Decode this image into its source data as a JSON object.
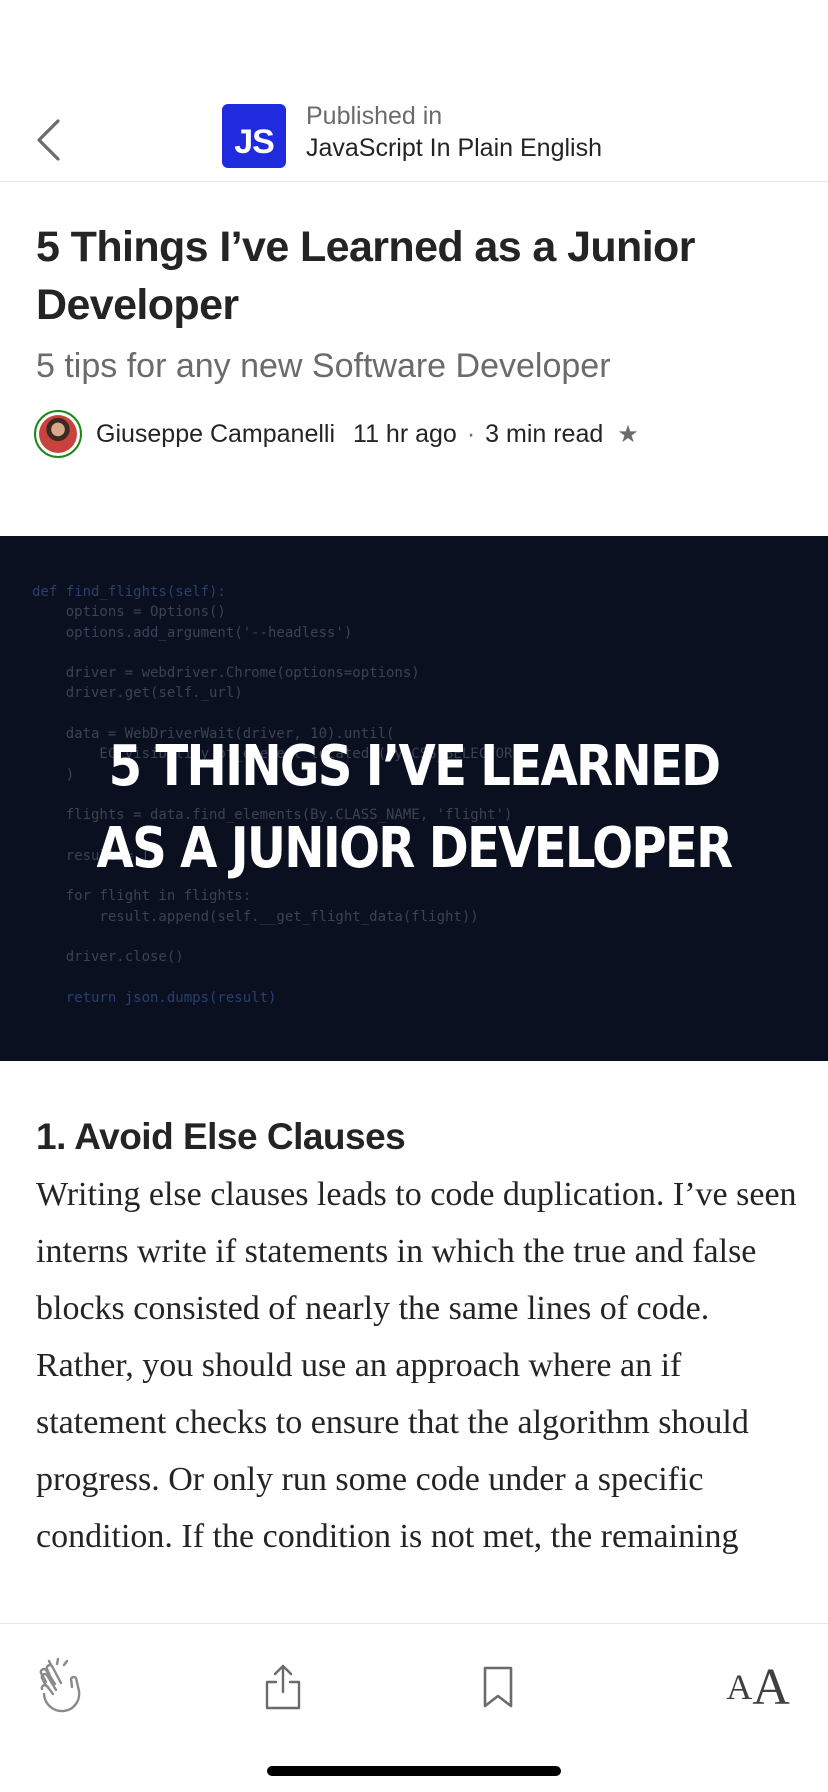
{
  "header": {
    "back_icon": "chevron-left-icon",
    "publication_logo": "JS",
    "published_in_label": "Published in",
    "publication_name": "JavaScript In Plain English"
  },
  "article": {
    "title": "5 Things I’ve Learned as a Junior Developer",
    "subtitle": "5 tips for any new Software Developer",
    "author": "Giuseppe Campanelli",
    "published_ago": "11 hr ago",
    "separator": "·",
    "read_time": "3 min read",
    "member_icon": "star-icon",
    "hero": {
      "headline_line1": "5 THINGS I’VE LEARNED",
      "headline_line2": "AS A JUNIOR DEVELOPER",
      "code_lines": [
        "def find_flights(self):",
        "    options = Options()",
        "    options.add_argument('--headless')",
        "",
        "    driver = webdriver.Chrome(options=options)",
        "    driver.get(self._url)",
        "",
        "    data = WebDriverWait(driver, 10).until(",
        "        EC.visibility_of_element_located((By.CSS_SELECTOR",
        "    )",
        "",
        "    flights = data.find_elements(By.CLASS_NAME, 'flight')",
        "",
        "    result = []",
        "",
        "    for flight in flights:",
        "        result.append(self.__get_flight_data(flight))",
        "",
        "    driver.close()",
        "",
        "    return json.dumps(result)"
      ]
    },
    "section_heading": "1. Avoid Else Clauses",
    "body_text": "Writing else clauses leads to code duplication. I’ve seen interns write if statements in which the true and false blocks consisted of nearly the same lines of code. Rather, you should use an approach where an if statement checks to ensure that the algorithm should progress. Or only run some code under a specific condition. If the condition is not met, the remaining"
  },
  "toolbar": {
    "clap_icon": "clap-icon",
    "share_icon": "share-icon",
    "bookmark_icon": "bookmark-icon",
    "text_size_small": "A",
    "text_size_large": "A"
  }
}
